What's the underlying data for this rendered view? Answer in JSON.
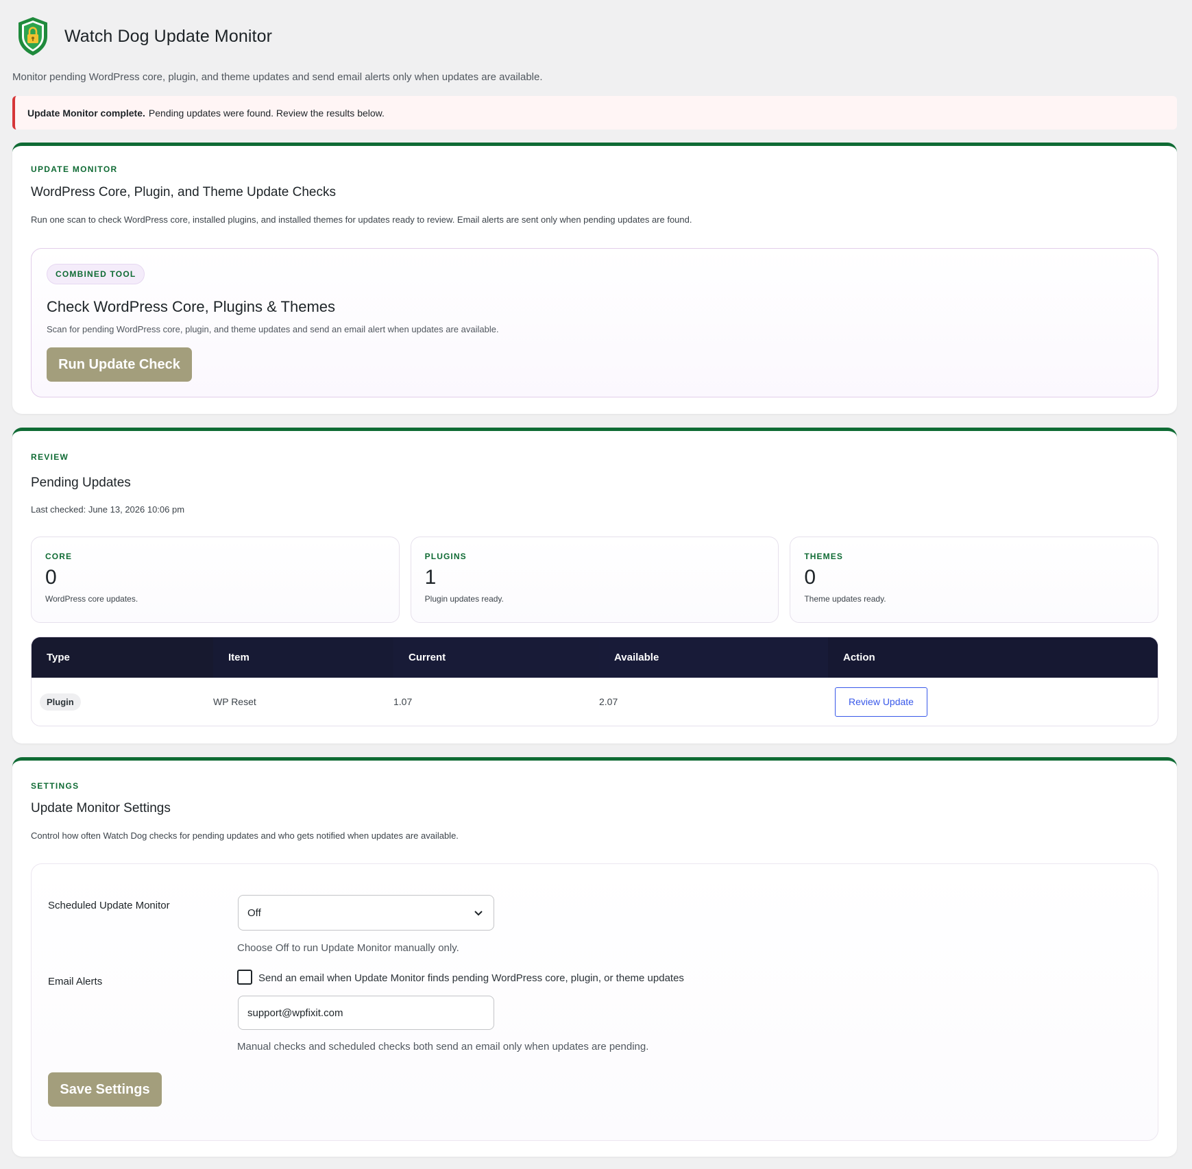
{
  "app": {
    "title": "Watch Dog Update Monitor",
    "description": "Monitor pending WordPress core, plugin, and theme updates and send email alerts only when updates are available.",
    "logo_icon": "shield-lock-icon",
    "accent_color": "#0f6b34",
    "button_color": "#a39e7c"
  },
  "notice": {
    "strong": "Update Monitor complete.",
    "text": "Pending updates were found. Review the results below.",
    "border_color": "#d63638"
  },
  "update_monitor": {
    "eyebrow": "UPDATE MONITOR",
    "title": "WordPress Core, Plugin, and Theme Update Checks",
    "description": "Run one scan to check WordPress core, installed plugins, and installed themes for updates ready to review. Email alerts are sent only when pending updates are found.",
    "tool": {
      "pill": "COMBINED TOOL",
      "title": "Check WordPress Core, Plugins & Themes",
      "description": "Scan for pending WordPress core, plugin, and theme updates and send an email alert when updates are available.",
      "button_label": "Run Update Check"
    }
  },
  "review": {
    "eyebrow": "REVIEW",
    "title": "Pending Updates",
    "last_checked": "Last checked: June 13, 2026 10:06 pm",
    "stats": [
      {
        "label": "CORE",
        "value": "0",
        "caption": "WordPress core updates."
      },
      {
        "label": "PLUGINS",
        "value": "1",
        "caption": "Plugin updates ready."
      },
      {
        "label": "THEMES",
        "value": "0",
        "caption": "Theme updates ready."
      }
    ],
    "table": {
      "headers": [
        "Type",
        "Item",
        "Current",
        "Available",
        "Action"
      ],
      "rows": [
        {
          "type": "Plugin",
          "item": "WP Reset",
          "current": "1.07",
          "available": "2.07",
          "action": "Review Update"
        }
      ]
    }
  },
  "settings": {
    "eyebrow": "SETTINGS",
    "title": "Update Monitor Settings",
    "description": "Control how often Watch Dog checks for pending updates and who gets notified when updates are available.",
    "schedule": {
      "label": "Scheduled Update Monitor",
      "value": "Off",
      "help": "Choose Off to run Update Monitor manually only."
    },
    "email": {
      "label": "Email Alerts",
      "checkbox_label": "Send an email when Update Monitor finds pending WordPress core, plugin, or theme updates",
      "checked": false,
      "address": "support@wpfixit.com",
      "help": "Manual checks and scheduled checks both send an email only when updates are pending."
    },
    "save_label": "Save Settings"
  }
}
